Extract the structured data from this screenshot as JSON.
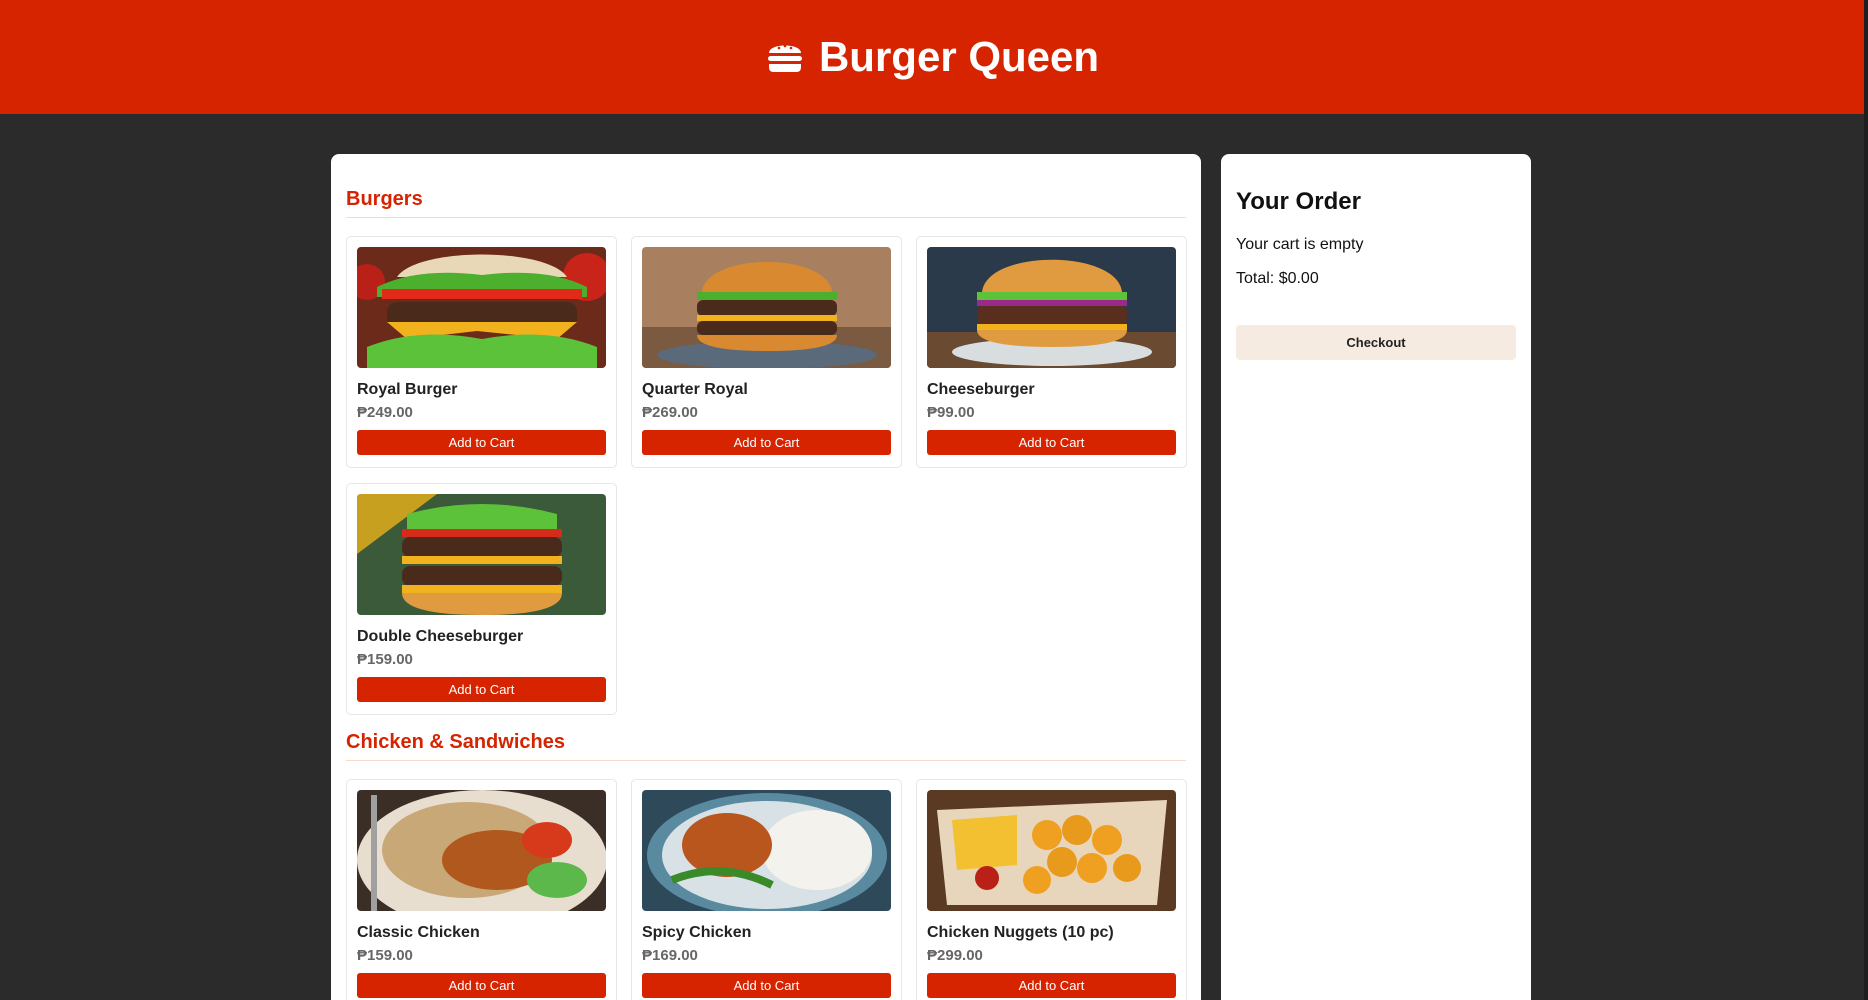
{
  "header": {
    "title": "Burger Queen",
    "icon": "burger-icon",
    "color": "#d62300"
  },
  "menu": {
    "categories": [
      {
        "title": "Burgers",
        "items": [
          {
            "name": "Royal Burger",
            "price": "₱249.00",
            "button": "Add to Cart",
            "image": "royal-burger-image"
          },
          {
            "name": "Quarter Royal",
            "price": "₱269.00",
            "button": "Add to Cart",
            "image": "quarter-royal-image"
          },
          {
            "name": "Cheeseburger",
            "price": "₱99.00",
            "button": "Add to Cart",
            "image": "cheeseburger-image"
          },
          {
            "name": "Double Cheeseburger",
            "price": "₱159.00",
            "button": "Add to Cart",
            "image": "double-cheeseburger-image"
          }
        ]
      },
      {
        "title": "Chicken & Sandwiches",
        "items": [
          {
            "name": "Classic Chicken",
            "price": "₱159.00",
            "button": "Add to Cart",
            "image": "classic-chicken-image"
          },
          {
            "name": "Spicy Chicken",
            "price": "₱169.00",
            "button": "Add to Cart",
            "image": "spicy-chicken-image"
          },
          {
            "name": "Chicken Nuggets (10 pc)",
            "price": "₱299.00",
            "button": "Add to Cart",
            "image": "chicken-nuggets-image"
          }
        ]
      }
    ]
  },
  "order": {
    "title": "Your Order",
    "empty_text": "Your cart is empty",
    "total": "Total: $0.00",
    "checkout_label": "Checkout"
  }
}
